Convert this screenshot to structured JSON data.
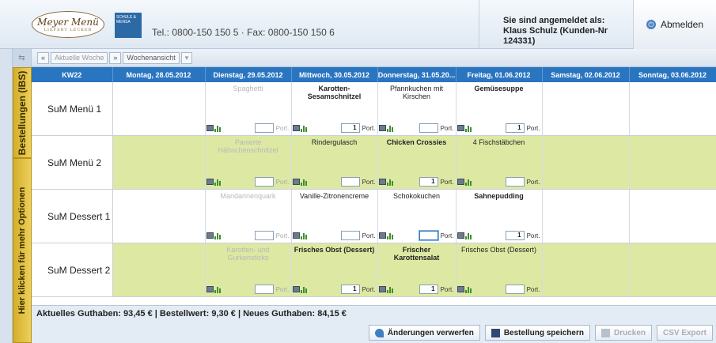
{
  "header": {
    "logo_text": "Meyer Menü",
    "logo_sub": "LIEFERT LECKER",
    "school_logo": "SCHULE & MENSA",
    "contact": "Tel.: 0800-150 150 5 · Fax: 0800-150 150 6",
    "login_line1": "Sie sind angemeldet als:",
    "login_line2": "Klaus Schulz (Kunden-Nr 124331)",
    "logout_label": "Abmelden"
  },
  "sidebar": {
    "tab_orders": "Bestellungen (IBS)",
    "tab_options": "Hier klicken für mehr Optionen"
  },
  "toolbar": {
    "prev": "«",
    "current_week": "Aktuelle Woche",
    "next": "»",
    "view": "Wochenansicht",
    "view_dropdown": "▾"
  },
  "grid": {
    "columns": [
      "KW22",
      "Montag, 28.05.2012",
      "Dienstag, 29.05.2012",
      "Mittwoch, 30.05.2012",
      "Donnerstag, 31.05.20...",
      "Freitag, 01.06.2012",
      "Samstag, 02.06.2012",
      "Sonntag, 03.06.2012"
    ],
    "port_label": "Port.",
    "rows": [
      {
        "label": "SuM Menü 1",
        "meals": [
          "",
          "Spaghetti",
          "Karotten-Sesamschnitzel",
          "Pfannkuchen mit Kirschen",
          "Gemüsesuppe",
          "",
          ""
        ],
        "qty": [
          "",
          "",
          "1",
          "",
          "1",
          "",
          ""
        ]
      },
      {
        "label": "SuM Menü 2",
        "meals": [
          "",
          "Panierte Hähnchenschnitzel",
          "Rindergulasch",
          "Chicken Crossies",
          "4 Fischstäbchen",
          "",
          ""
        ],
        "qty": [
          "",
          "",
          "",
          "1",
          "",
          "",
          ""
        ]
      },
      {
        "label": "SuM Dessert 1",
        "meals": [
          "",
          "Mandarinenquark",
          "Vanille-Zitronencreme",
          "Schokokuchen",
          "Sahnepudding",
          "",
          ""
        ],
        "qty": [
          "",
          "",
          "",
          "",
          "1",
          "",
          ""
        ]
      },
      {
        "label": "SuM Dessert 2",
        "meals": [
          "",
          "Karotten- und Gurkensticks",
          "Frisches Obst (Dessert)",
          "Frischer Karottensalat",
          "Frisches Obst (Dessert)",
          "",
          ""
        ],
        "qty": [
          "",
          "",
          "1",
          "1",
          "",
          "",
          ""
        ]
      }
    ]
  },
  "summary": "Aktuelles Guthaben: 93,45 € | Bestellwert: 9,30 € | Neues Guthaben: 84,15 €",
  "actions": {
    "discard": "Änderungen verwerfen",
    "save": "Bestellung speichern",
    "print": "Drucken",
    "csv": "CSV Export"
  }
}
